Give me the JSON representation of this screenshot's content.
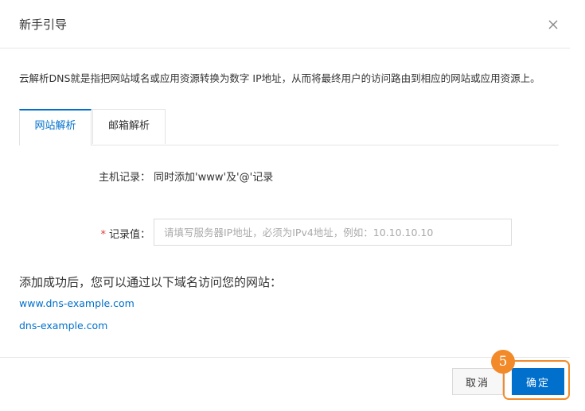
{
  "dialog": {
    "title": "新手引导",
    "close_icon": "close-icon"
  },
  "intro": {
    "text": "云解析DNS就是指把网站域名或应用资源转换为数字 IP地址，从而将最终用户的访问路由到相应的网站或应用资源上。"
  },
  "tabs": [
    {
      "label": "网站解析",
      "active": true
    },
    {
      "label": "邮箱解析",
      "active": false
    }
  ],
  "form": {
    "host_label": "主机记录：",
    "host_value": "同时添加'www'及'@'记录",
    "record_required_mark": "*",
    "record_label": "记录值：",
    "record_value": "",
    "record_placeholder": "请填写服务器IP地址，必须为IPv4地址，例如：10.10.10.10"
  },
  "result": {
    "message": "添加成功后，您可以通过以下域名访问您的网站：",
    "domains": [
      "www.dns-example.com",
      "dns-example.com"
    ]
  },
  "footer": {
    "cancel_label": "取消",
    "ok_label": "确定",
    "step_number": "5"
  },
  "colors": {
    "accent": "#0070cc",
    "highlight": "#f28a2a",
    "required": "#e4393c"
  }
}
